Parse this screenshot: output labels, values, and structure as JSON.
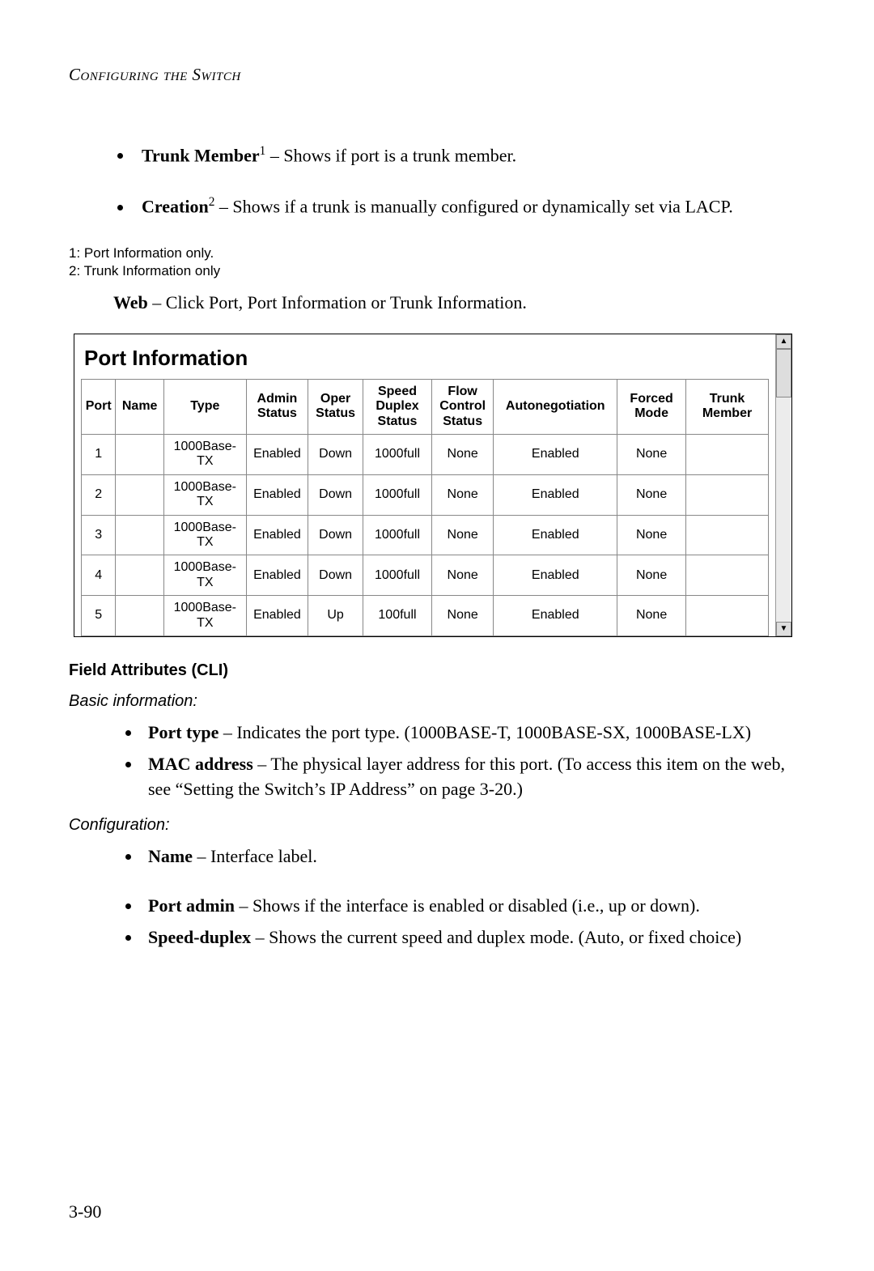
{
  "section_header": "Configuring the Switch",
  "top_bullets": [
    {
      "term": "Trunk Member",
      "sup": "1",
      "desc": " – Shows if port is a trunk member."
    },
    {
      "term": "Creation",
      "sup": "2",
      "desc": " – Shows if a trunk is manually configured or dynamically set via LACP."
    }
  ],
  "footnotes": [
    "1: Port Information only.",
    "2: Trunk Information only"
  ],
  "web_line": {
    "label": "Web",
    "text": " – Click Port, Port Information or Trunk Information."
  },
  "panel": {
    "title": "Port Information",
    "headers": [
      "Port",
      "Name",
      "Type",
      "Admin Status",
      "Oper Status",
      "Speed Duplex Status",
      "Flow Control Status",
      "Autonegotiation",
      "Forced Mode",
      "Trunk Member"
    ],
    "col_widths": [
      "5%",
      "7%",
      "12%",
      "9%",
      "8%",
      "10%",
      "9%",
      "18%",
      "10%",
      "12%"
    ],
    "rows": [
      [
        "1",
        "",
        "1000Base-TX",
        "Enabled",
        "Down",
        "1000full",
        "None",
        "Enabled",
        "None",
        ""
      ],
      [
        "2",
        "",
        "1000Base-TX",
        "Enabled",
        "Down",
        "1000full",
        "None",
        "Enabled",
        "None",
        ""
      ],
      [
        "3",
        "",
        "1000Base-TX",
        "Enabled",
        "Down",
        "1000full",
        "None",
        "Enabled",
        "None",
        ""
      ],
      [
        "4",
        "",
        "1000Base-TX",
        "Enabled",
        "Down",
        "1000full",
        "None",
        "Enabled",
        "None",
        ""
      ],
      [
        "5",
        "",
        "1000Base-TX",
        "Enabled",
        "Up",
        "100full",
        "None",
        "Enabled",
        "None",
        ""
      ]
    ]
  },
  "field_attr_heading": "Field Attributes (CLI)",
  "basic_info_label": "Basic information:",
  "basic_info_bullets": [
    {
      "term": "Port type",
      "desc": " – Indicates the port type. (1000BASE-T, 1000BASE-SX, 1000BASE-LX)"
    },
    {
      "term": "MAC address",
      "desc": " – The physical layer address for this port. (To access this item on the web, see “Setting the Switch’s IP Address” on page 3-20.)"
    }
  ],
  "config_label": "Configuration:",
  "config_bullets": [
    {
      "term": "Name",
      "desc": " – Interface label."
    },
    {
      "term": "Port admin",
      "desc": " – Shows if the interface is enabled or disabled (i.e., up or down)."
    },
    {
      "term": "Speed-duplex",
      "desc": " – Shows the current speed and duplex mode. (Auto, or fixed choice)"
    }
  ],
  "page_number": "3-90"
}
